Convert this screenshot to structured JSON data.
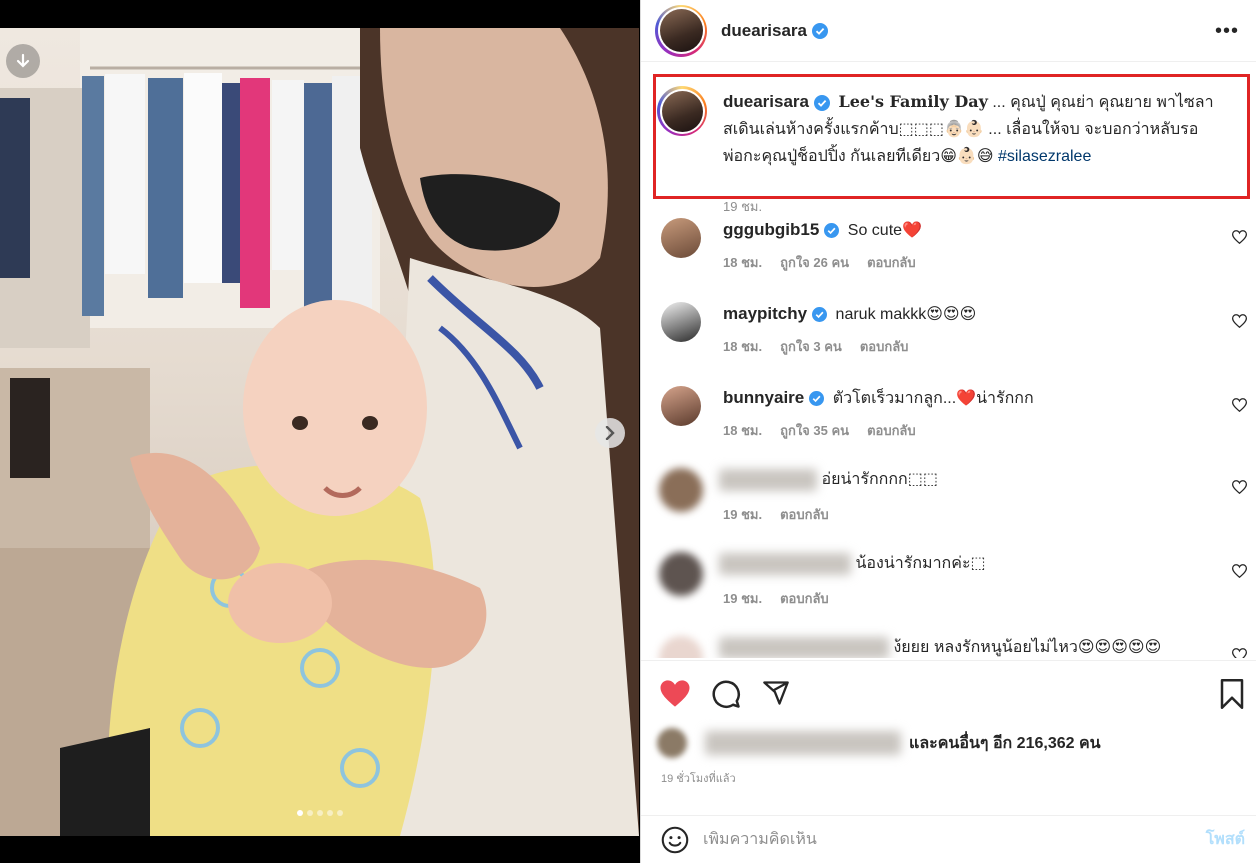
{
  "post": {
    "username": "duearisara",
    "more_label": "•••"
  },
  "caption": {
    "username": "duearisara",
    "title": "Lee's Family Day",
    "text_line1": " ... คุณปู่ คุณย่า คุณยาย พาไซลา",
    "text_line2": "สเดินเล่นห้างครั้งแรกค้าบ⬚⬚⬚👵🏻👶🏻 ... เลื่อนให้จบ จะบอกว่าหลับรอ",
    "text_line3": "พ่อกะคุณปู่ช็อปปิ้ง กันเลยทีเดียว😁👶🏻😅",
    "hashtag": "#silasezralee",
    "time": "19 ชม."
  },
  "comments": [
    {
      "username": "gggubgib15",
      "text": "So cute❤️",
      "time": "18 ชม.",
      "likes": "ถูกใจ 26 คน",
      "reply": "ตอบกลับ",
      "blurred": false
    },
    {
      "username": "maypitchy",
      "text": "naruk makkk😍😍😍",
      "time": "18 ชม.",
      "likes": "ถูกใจ 3 คน",
      "reply": "ตอบกลับ",
      "blurred": false
    },
    {
      "username": "bunnyaire",
      "text": "ตัวโตเร็วมากลูก...❤️น่ารักกก",
      "time": "18 ชม.",
      "likes": "ถูกใจ 35 คน",
      "reply": "ตอบกลับ",
      "blurred": false
    },
    {
      "username": "",
      "text": "อ่ยน่ารักกกก⬚⬚",
      "time": "19 ชม.",
      "likes": "",
      "reply": "ตอบกลับ",
      "blurred": true
    },
    {
      "username": "",
      "text": "น้องน่ารักมากค่ะ⬚",
      "time": "19 ชม.",
      "likes": "",
      "reply": "ตอบกลับ",
      "blurred": true
    },
    {
      "username": "",
      "text": "ง้ยยย หลงรักหนูน้อยไม่ไหว😍😍😍😍😍",
      "time": "",
      "likes": "",
      "reply": "",
      "blurred": true
    }
  ],
  "likes_summary": "และคนอื่นๆ อีก 216,362 คน",
  "timestamp": "19 ชั่วโมงที่แล้ว",
  "add_comment": {
    "placeholder": "เพิ่มความคิดเห็น",
    "post_label": "โพสต์"
  },
  "colors": {
    "like_red": "#ed4956",
    "highlight_box": "#e02424",
    "verified_blue": "#3897f0",
    "hashtag": "#00376b"
  },
  "icons": [
    "download-icon",
    "chevron-right-icon",
    "verified-icon",
    "more-icon",
    "heart-icon",
    "comment-icon",
    "share-icon",
    "bookmark-icon",
    "emoji-icon"
  ]
}
